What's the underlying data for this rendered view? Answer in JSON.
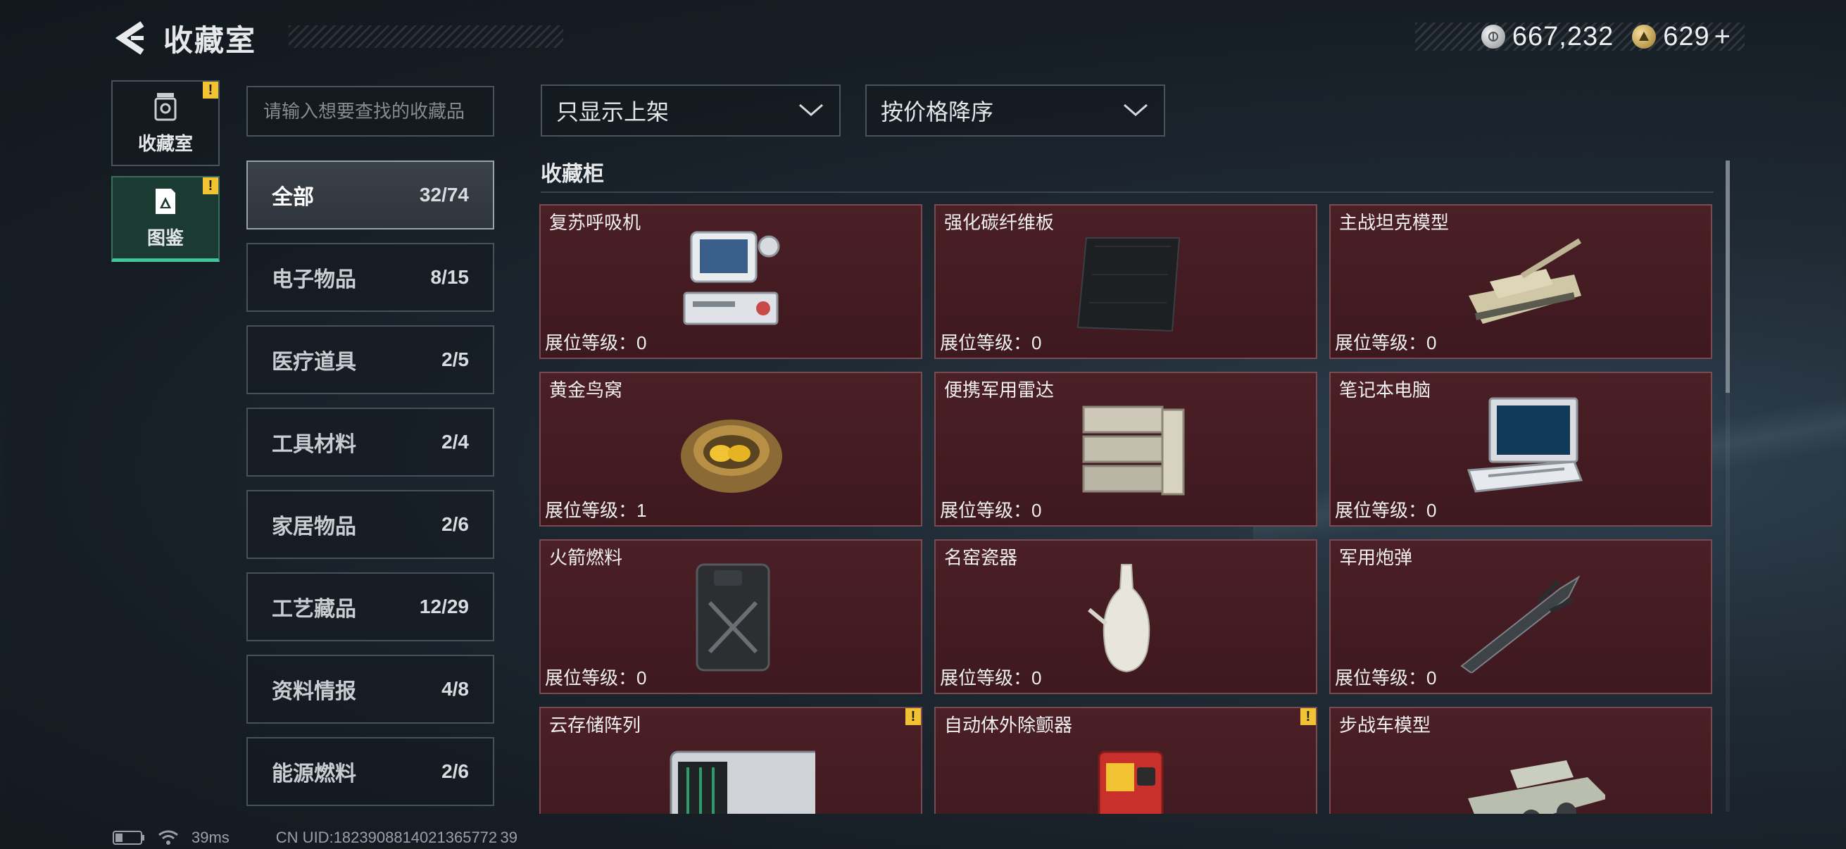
{
  "header": {
    "title": "收藏室"
  },
  "currency": {
    "silver_value": "667,232",
    "gold_value": "629",
    "add_label": "+"
  },
  "side_nav": [
    {
      "label": "收藏室",
      "alert": "!"
    },
    {
      "label": "图鉴",
      "alert": "!"
    }
  ],
  "search": {
    "placeholder": "请输入想要查找的收藏品"
  },
  "categories": [
    {
      "name": "全部",
      "count": "32/74"
    },
    {
      "name": "电子物品",
      "count": "8/15"
    },
    {
      "name": "医疗道具",
      "count": "2/5"
    },
    {
      "name": "工具材料",
      "count": "2/4"
    },
    {
      "name": "家居物品",
      "count": "2/6"
    },
    {
      "name": "工艺藏品",
      "count": "12/29"
    },
    {
      "name": "资料情报",
      "count": "4/8"
    },
    {
      "name": "能源燃料",
      "count": "2/6"
    }
  ],
  "filters": {
    "filter_label": "只显示上架",
    "sort_label": "按价格降序"
  },
  "section": {
    "title": "收藏柜"
  },
  "items": [
    {
      "name": "复苏呼吸机",
      "level": "展位等级：0"
    },
    {
      "name": "强化碳纤维板",
      "level": "展位等级：0"
    },
    {
      "name": "主战坦克模型",
      "level": "展位等级：0"
    },
    {
      "name": "黄金鸟窝",
      "level": "展位等级：1"
    },
    {
      "name": "便携军用雷达",
      "level": "展位等级：0"
    },
    {
      "name": "笔记本电脑",
      "level": "展位等级：0"
    },
    {
      "name": "火箭燃料",
      "level": "展位等级：0"
    },
    {
      "name": "名窑瓷器",
      "level": "展位等级：0"
    },
    {
      "name": "军用炮弹",
      "level": "展位等级：0"
    },
    {
      "name": "云存储阵列",
      "level": "",
      "alert": "!"
    },
    {
      "name": "自动体外除颤器",
      "level": "",
      "alert": "!"
    },
    {
      "name": "步战车模型",
      "level": ""
    }
  ],
  "status_bar": {
    "ping": "39ms",
    "uid": "CN UID:1823908814021365772 39"
  },
  "colors": {
    "accent_green": "#3ec79a",
    "card_bg": "#4b1f26",
    "alert_yellow": "#f1c232"
  }
}
